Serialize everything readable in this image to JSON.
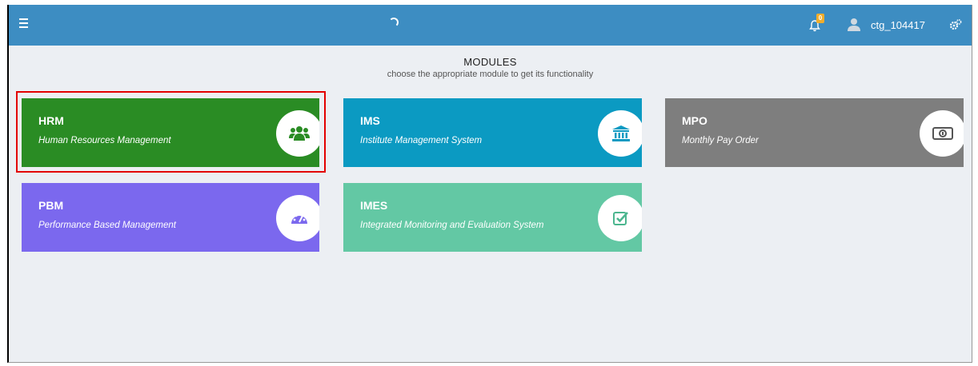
{
  "topbar": {
    "notification_count": "0",
    "username": "ctg_104417"
  },
  "heading": {
    "title": "MODULES",
    "subtitle": "choose the appropriate module to get its functionality"
  },
  "modules": [
    {
      "abbr": "HRM",
      "name": "Human Resources Management",
      "icon": "users-icon",
      "color": "#2a8c24"
    },
    {
      "abbr": "IMS",
      "name": "Institute Management System",
      "icon": "institution-icon",
      "color": "#0b9ac2"
    },
    {
      "abbr": "MPO",
      "name": "Monthly Pay Order",
      "icon": "money-icon",
      "color": "#7e7e7e"
    },
    {
      "abbr": "PBM",
      "name": "Performance Based Management",
      "icon": "dashboard-icon",
      "color": "#7b68ee"
    },
    {
      "abbr": "IMES",
      "name": "Integrated Monitoring and Evaluation System",
      "icon": "check-square-icon",
      "color": "#63c8a4"
    }
  ],
  "colors": {
    "topbar": "#3d8dc2",
    "highlight": "#e30000"
  }
}
